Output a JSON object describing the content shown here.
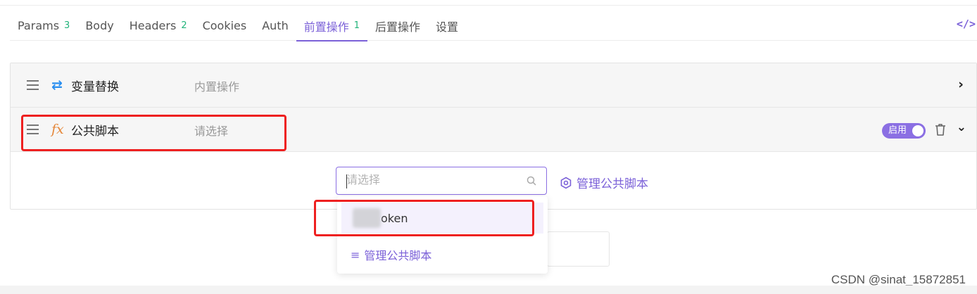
{
  "tabs": [
    {
      "label": "Params",
      "count": "3"
    },
    {
      "label": "Body",
      "count": ""
    },
    {
      "label": "Headers",
      "count": "2"
    },
    {
      "label": "Cookies",
      "count": ""
    },
    {
      "label": "Auth",
      "count": ""
    },
    {
      "label": "前置操作",
      "count": "1"
    },
    {
      "label": "后置操作",
      "count": ""
    },
    {
      "label": "设置",
      "count": ""
    }
  ],
  "active_tab": "前置操作",
  "code_toggle": "</>",
  "operations": [
    {
      "icon": "loop-arrows-icon",
      "name": "变量替换",
      "type": "内置操作"
    },
    {
      "icon": "fx-icon",
      "name": "公共脚本",
      "type": "请选择",
      "toggle_label": "启用",
      "enabled": true
    }
  ],
  "script_select": {
    "placeholder": "请选择",
    "manage_link": "管理公共脚本"
  },
  "dropdown": {
    "options": [
      "oken"
    ],
    "manage_label": "管理公共脚本"
  },
  "watermark": "CSDN @sinat_15872851",
  "colors": {
    "accent": "#7b61d8",
    "count": "#21b37a",
    "highlight": "#ee2020",
    "loop_icon": "#2a8ff0",
    "fx_icon": "#e5873a"
  }
}
